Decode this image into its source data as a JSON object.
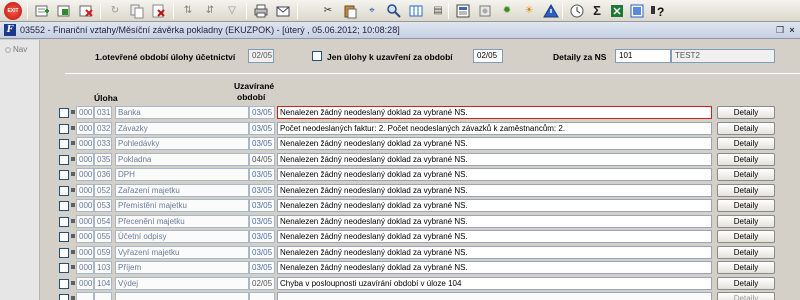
{
  "toolbar": {
    "icons": [
      "exit-icon",
      "new-record-icon",
      "copy-record-icon",
      "delete-record-icon",
      "refresh-icon",
      "copy-icon",
      "delete-icon",
      "sort-asc-icon",
      "sort-desc-icon",
      "filter-icon",
      "print-icon",
      "email-icon",
      "cut-icon",
      "paste-icon",
      "find-icon",
      "zoom-icon",
      "columns-icon",
      "calc-icon",
      "document-icon",
      "settings-icon",
      "star-icon",
      "warning-icon",
      "clock-icon",
      "sum-icon",
      "excel-icon",
      "export-icon",
      "help-icon"
    ],
    "exit_label": "EXIT"
  },
  "window": {
    "title": "03552 - Finanční vztahy/Měsíční závěrka pokladny (EKUZPOK) - [úterý , 05.06.2012; 10:08:28]",
    "icon_letter": "F"
  },
  "nav": {
    "label": "Nav"
  },
  "header": {
    "period_label": "1.otevřené období úlohy účetnictví",
    "period_value": "02/05",
    "only_tasks_label": "Jen úlohy k uzavření za období",
    "only_tasks_value": "02/05",
    "details_label": "Detaily za NS",
    "ns_code": "101",
    "ns_name": "TEST2"
  },
  "columns": {
    "task": "Úloha",
    "closed_period_line1": "Uzavírané",
    "closed_period_line2": "období"
  },
  "rows": [
    {
      "code1": "000",
      "code2": "031",
      "name": "Banka",
      "period": "03/05",
      "message": "Nenalezen žádný neodeslaný doklad za vybrané NS.",
      "button": "Detaily",
      "selected": true,
      "dim": true
    },
    {
      "code1": "000",
      "code2": "032",
      "name": "Závazky",
      "period": "03/05",
      "message": "Počet neodeslaných faktur: 2. Počet neodeslaných závazků k zaměstnancům: 2.",
      "button": "Detaily",
      "selected": false,
      "dim": true
    },
    {
      "code1": "000",
      "code2": "033",
      "name": "Pohledávky",
      "period": "03/05",
      "message": "Nenalezen žádný neodeslaný doklad za vybrané NS.",
      "button": "Detaily",
      "selected": false,
      "dim": true
    },
    {
      "code1": "000",
      "code2": "035",
      "name": "Pokladna",
      "period": "04/05",
      "message": "Nenalezen žádný neodeslaný doklad za vybrané NS.",
      "button": "Detaily",
      "selected": false,
      "dim": false
    },
    {
      "code1": "000",
      "code2": "036",
      "name": "DPH",
      "period": "03/05",
      "message": "Nenalezen žádný neodeslaný doklad za vybrané NS.",
      "button": "Detaily",
      "selected": false,
      "dim": true
    },
    {
      "code1": "000",
      "code2": "052",
      "name": "Zařazení majetku",
      "period": "03/05",
      "message": "Nenalezen žádný neodeslaný doklad za vybrané NS.",
      "button": "Detaily",
      "selected": false,
      "dim": true
    },
    {
      "code1": "000",
      "code2": "053",
      "name": "Přemístění majetku",
      "period": "03/05",
      "message": "Nenalezen žádný neodeslaný doklad za vybrané NS.",
      "button": "Detaily",
      "selected": false,
      "dim": true
    },
    {
      "code1": "000",
      "code2": "054",
      "name": "Přecenění majetku",
      "period": "03/05",
      "message": "Nenalezen žádný neodeslaný doklad za vybrané NS.",
      "button": "Detaily",
      "selected": false,
      "dim": true
    },
    {
      "code1": "000",
      "code2": "055",
      "name": "Účetní odpisy",
      "period": "03/05",
      "message": "Nenalezen žádný neodeslaný doklad za vybrané NS.",
      "button": "Detaily",
      "selected": false,
      "dim": true
    },
    {
      "code1": "000",
      "code2": "059",
      "name": "Vyřazení majetku",
      "period": "03/05",
      "message": "Nenalezen žádný neodeslaný doklad za vybrané NS.",
      "button": "Detaily",
      "selected": false,
      "dim": true
    },
    {
      "code1": "000",
      "code2": "103",
      "name": "Příjem",
      "period": "03/05",
      "message": "Nenalezen žádný neodeslaný doklad za vybrané NS.",
      "button": "Detaily",
      "selected": false,
      "dim": true
    },
    {
      "code1": "000",
      "code2": "104",
      "name": "Výdej",
      "period": "02/05",
      "message": "Chyba v posloupnosti uzavírání období v úloze 104",
      "button": "Detaily",
      "selected": false,
      "dim": false
    },
    {
      "code1": "",
      "code2": "",
      "name": "",
      "period": "",
      "message": "",
      "button": "Detaily",
      "selected": false,
      "dim": false,
      "empty": true
    }
  ]
}
